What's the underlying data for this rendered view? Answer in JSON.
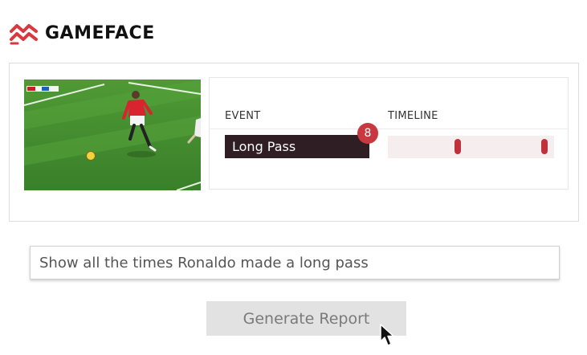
{
  "brand": {
    "name_prefix": "GAME",
    "name_suffix": "FACE",
    "icon": "gameface-logo-icon",
    "accent_color": "#d9383f"
  },
  "video": {
    "icon": "soccer-clip-thumbnail"
  },
  "results": {
    "columns": {
      "event": "EVENT",
      "timeline": "TIMELINE"
    },
    "rows": [
      {
        "event": "Long Pass",
        "count": "8",
        "timeline_markers": [
          0.42,
          0.94
        ]
      }
    ]
  },
  "query": {
    "value": "Show all the times Ronaldo made a long pass"
  },
  "actions": {
    "generate_label": "Generate Report"
  },
  "colors": {
    "event_pill": "#2f1e24",
    "badge": "#c9373f",
    "timeline_track": "#f6eeee",
    "timeline_marker": "#c0313b",
    "button_bg": "#e2e2e2"
  }
}
